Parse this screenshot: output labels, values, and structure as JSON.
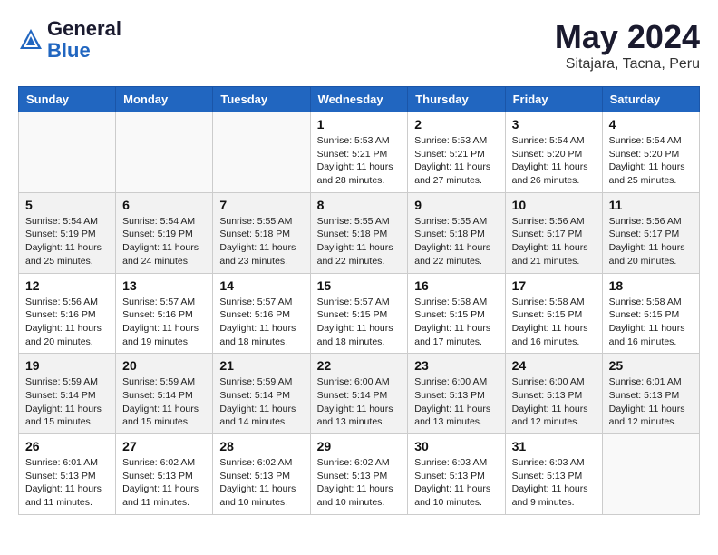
{
  "header": {
    "logo_line1": "General",
    "logo_line2": "Blue",
    "title": "May 2024",
    "location": "Sitajara, Tacna, Peru"
  },
  "weekdays": [
    "Sunday",
    "Monday",
    "Tuesday",
    "Wednesday",
    "Thursday",
    "Friday",
    "Saturday"
  ],
  "weeks": [
    [
      {
        "num": "",
        "info": ""
      },
      {
        "num": "",
        "info": ""
      },
      {
        "num": "",
        "info": ""
      },
      {
        "num": "1",
        "info": "Sunrise: 5:53 AM\nSunset: 5:21 PM\nDaylight: 11 hours\nand 28 minutes."
      },
      {
        "num": "2",
        "info": "Sunrise: 5:53 AM\nSunset: 5:21 PM\nDaylight: 11 hours\nand 27 minutes."
      },
      {
        "num": "3",
        "info": "Sunrise: 5:54 AM\nSunset: 5:20 PM\nDaylight: 11 hours\nand 26 minutes."
      },
      {
        "num": "4",
        "info": "Sunrise: 5:54 AM\nSunset: 5:20 PM\nDaylight: 11 hours\nand 25 minutes."
      }
    ],
    [
      {
        "num": "5",
        "info": "Sunrise: 5:54 AM\nSunset: 5:19 PM\nDaylight: 11 hours\nand 25 minutes."
      },
      {
        "num": "6",
        "info": "Sunrise: 5:54 AM\nSunset: 5:19 PM\nDaylight: 11 hours\nand 24 minutes."
      },
      {
        "num": "7",
        "info": "Sunrise: 5:55 AM\nSunset: 5:18 PM\nDaylight: 11 hours\nand 23 minutes."
      },
      {
        "num": "8",
        "info": "Sunrise: 5:55 AM\nSunset: 5:18 PM\nDaylight: 11 hours\nand 22 minutes."
      },
      {
        "num": "9",
        "info": "Sunrise: 5:55 AM\nSunset: 5:18 PM\nDaylight: 11 hours\nand 22 minutes."
      },
      {
        "num": "10",
        "info": "Sunrise: 5:56 AM\nSunset: 5:17 PM\nDaylight: 11 hours\nand 21 minutes."
      },
      {
        "num": "11",
        "info": "Sunrise: 5:56 AM\nSunset: 5:17 PM\nDaylight: 11 hours\nand 20 minutes."
      }
    ],
    [
      {
        "num": "12",
        "info": "Sunrise: 5:56 AM\nSunset: 5:16 PM\nDaylight: 11 hours\nand 20 minutes."
      },
      {
        "num": "13",
        "info": "Sunrise: 5:57 AM\nSunset: 5:16 PM\nDaylight: 11 hours\nand 19 minutes."
      },
      {
        "num": "14",
        "info": "Sunrise: 5:57 AM\nSunset: 5:16 PM\nDaylight: 11 hours\nand 18 minutes."
      },
      {
        "num": "15",
        "info": "Sunrise: 5:57 AM\nSunset: 5:15 PM\nDaylight: 11 hours\nand 18 minutes."
      },
      {
        "num": "16",
        "info": "Sunrise: 5:58 AM\nSunset: 5:15 PM\nDaylight: 11 hours\nand 17 minutes."
      },
      {
        "num": "17",
        "info": "Sunrise: 5:58 AM\nSunset: 5:15 PM\nDaylight: 11 hours\nand 16 minutes."
      },
      {
        "num": "18",
        "info": "Sunrise: 5:58 AM\nSunset: 5:15 PM\nDaylight: 11 hours\nand 16 minutes."
      }
    ],
    [
      {
        "num": "19",
        "info": "Sunrise: 5:59 AM\nSunset: 5:14 PM\nDaylight: 11 hours\nand 15 minutes."
      },
      {
        "num": "20",
        "info": "Sunrise: 5:59 AM\nSunset: 5:14 PM\nDaylight: 11 hours\nand 15 minutes."
      },
      {
        "num": "21",
        "info": "Sunrise: 5:59 AM\nSunset: 5:14 PM\nDaylight: 11 hours\nand 14 minutes."
      },
      {
        "num": "22",
        "info": "Sunrise: 6:00 AM\nSunset: 5:14 PM\nDaylight: 11 hours\nand 13 minutes."
      },
      {
        "num": "23",
        "info": "Sunrise: 6:00 AM\nSunset: 5:13 PM\nDaylight: 11 hours\nand 13 minutes."
      },
      {
        "num": "24",
        "info": "Sunrise: 6:00 AM\nSunset: 5:13 PM\nDaylight: 11 hours\nand 12 minutes."
      },
      {
        "num": "25",
        "info": "Sunrise: 6:01 AM\nSunset: 5:13 PM\nDaylight: 11 hours\nand 12 minutes."
      }
    ],
    [
      {
        "num": "26",
        "info": "Sunrise: 6:01 AM\nSunset: 5:13 PM\nDaylight: 11 hours\nand 11 minutes."
      },
      {
        "num": "27",
        "info": "Sunrise: 6:02 AM\nSunset: 5:13 PM\nDaylight: 11 hours\nand 11 minutes."
      },
      {
        "num": "28",
        "info": "Sunrise: 6:02 AM\nSunset: 5:13 PM\nDaylight: 11 hours\nand 10 minutes."
      },
      {
        "num": "29",
        "info": "Sunrise: 6:02 AM\nSunset: 5:13 PM\nDaylight: 11 hours\nand 10 minutes."
      },
      {
        "num": "30",
        "info": "Sunrise: 6:03 AM\nSunset: 5:13 PM\nDaylight: 11 hours\nand 10 minutes."
      },
      {
        "num": "31",
        "info": "Sunrise: 6:03 AM\nSunset: 5:13 PM\nDaylight: 11 hours\nand 9 minutes."
      },
      {
        "num": "",
        "info": ""
      }
    ]
  ]
}
